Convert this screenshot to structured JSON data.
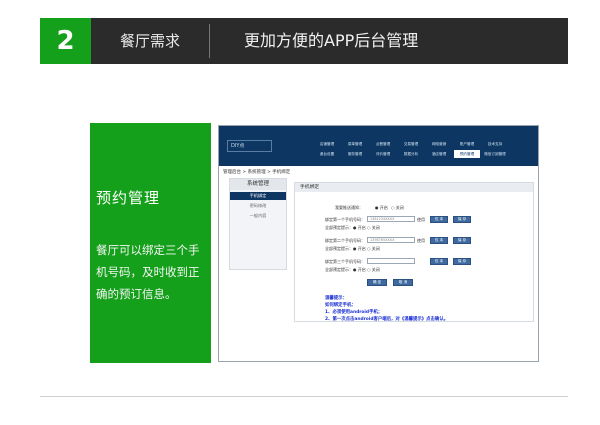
{
  "header": {
    "number": "2",
    "section": "餐厅需求",
    "title": "更加方便的APP后台管理"
  },
  "panel": {
    "title": "预约管理",
    "body": "餐厅可以绑定三个手机号码，及时收到正确的预订信息。"
  },
  "screenshot": {
    "logo": "DIY点",
    "nav_row1": [
      "店铺管理",
      "菜单管理",
      "点餐管理",
      "交易管理",
      "网络营销",
      "账户管理",
      "技术支持"
    ],
    "nav_row2": [
      "桌台设置",
      "服务管理",
      "评价管理",
      "数据分析",
      "酒店管理",
      "预约管理",
      "微信订阅管理"
    ],
    "nav_active": "预约管理",
    "breadcrumb": "管理后台 > 系统管理 > 手机绑定",
    "sidebar": {
      "heading": "系统管理",
      "items": [
        "手机绑定",
        "密码修改",
        "一般内容"
      ],
      "active": "手机绑定"
    },
    "content_title": "手机绑定",
    "form": {
      "status_label": "我要推送通知：",
      "status_opts": [
        "● 开启",
        "○ 关闭"
      ],
      "rows": [
        {
          "label": "绑定第一个手机号码：",
          "placeholder": "1381234XXXX",
          "suffix": "使用",
          "sub": "全部预定提示：● 开启 ○ 关闭",
          "btns": [
            "仅 本",
            "保 存"
          ]
        },
        {
          "label": "绑定第二个手机号码：",
          "placeholder": "1398765XXXX",
          "suffix": "使用",
          "sub": "全部预定提示：● 开启 ○ 关闭",
          "btns": [
            "仅 本",
            "保 存"
          ]
        },
        {
          "label": "绑定第三个手机号码：",
          "placeholder": "",
          "suffix": "",
          "sub": "全部预定提示：● 开启 ○ 关闭",
          "btns": [
            "仅 本",
            "保 存"
          ]
        }
      ],
      "submit": "确 定",
      "cancel": "取 消"
    },
    "tips": [
      "温馨提示：",
      "如何绑定手机：",
      "1、必须使用android手机；",
      "2、第一次点击android客户端后，对《温馨提示》点击确认。"
    ]
  }
}
